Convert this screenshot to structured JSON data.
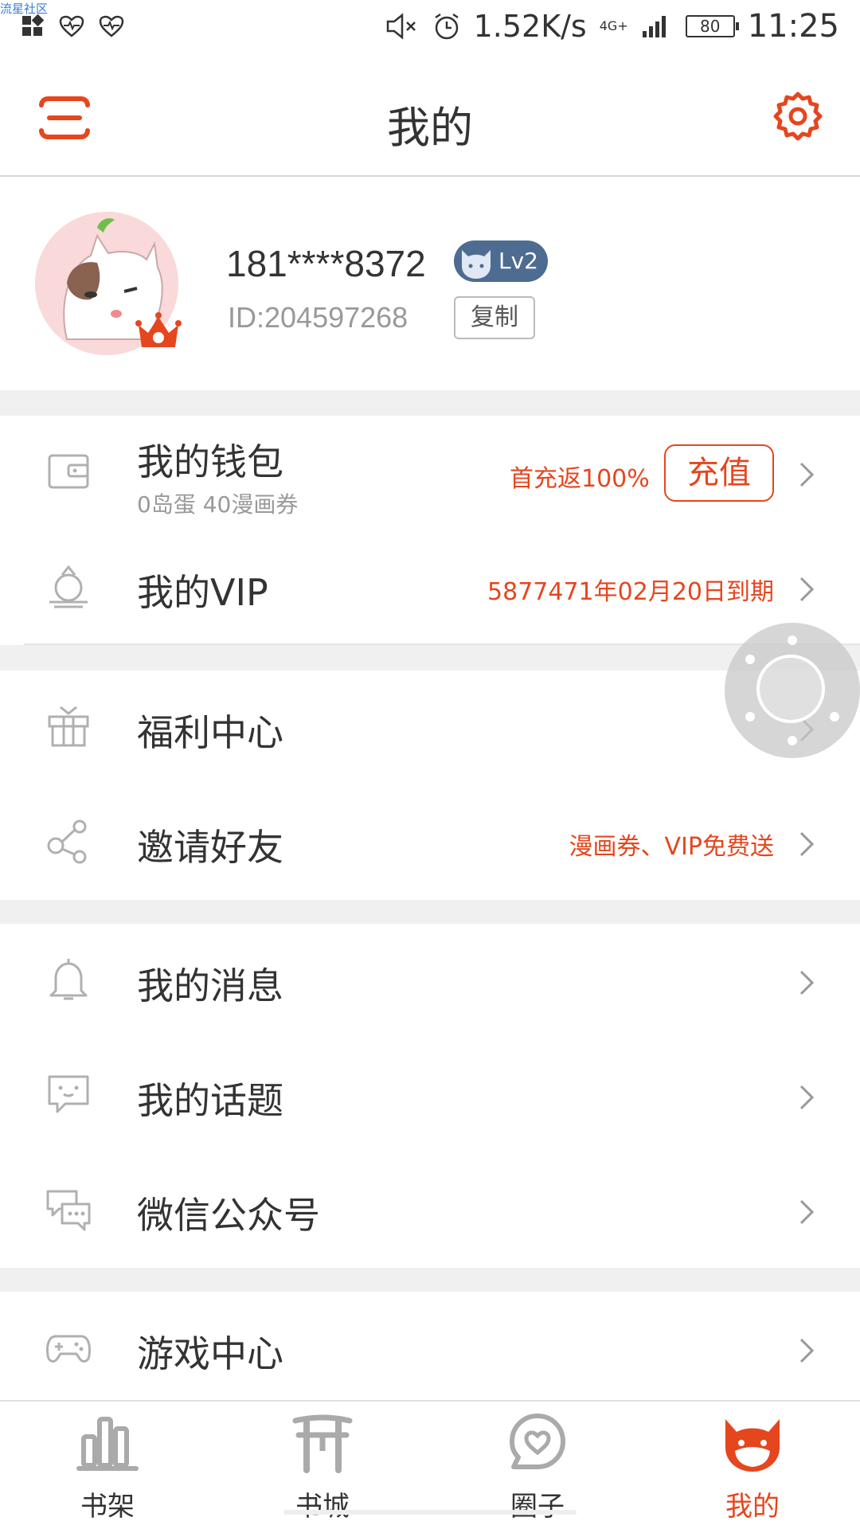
{
  "status_bar": {
    "corner_text": "流星社区",
    "network_speed": "1.52K/s",
    "network_type": "4G+",
    "battery": "80",
    "time": "11:25"
  },
  "header": {
    "title": "我的",
    "menu_icon": "menu-icon",
    "settings_icon": "gear-icon"
  },
  "profile": {
    "phone": "181****8372",
    "level": "Lv2",
    "user_id": "ID:204597268",
    "copy_label": "复制"
  },
  "wallet": {
    "title": "我的钱包",
    "balance": "0岛蛋 40漫画券",
    "promo": "首充返100%",
    "charge_label": "充值"
  },
  "vip": {
    "title": "我的VIP",
    "expiry": "5877471年02月20日到期"
  },
  "welfare": {
    "title": "福利中心"
  },
  "invite": {
    "title": "邀请好友",
    "note": "漫画券、VIP免费送"
  },
  "messages": {
    "title": "我的消息"
  },
  "topics": {
    "title": "我的话题"
  },
  "wechat": {
    "title": "微信公众号"
  },
  "games": {
    "title": "游戏中心"
  },
  "bottom_nav": {
    "items": [
      {
        "label": "书架",
        "icon": "bookshelf-icon"
      },
      {
        "label": "书城",
        "icon": "bookstore-icon"
      },
      {
        "label": "圈子",
        "icon": "community-icon"
      },
      {
        "label": "我的",
        "icon": "cat-face-icon",
        "active": true
      }
    ]
  },
  "colors": {
    "accent": "#e5461e",
    "text": "#333333",
    "muted": "#999999",
    "divider": "#f0f0f0",
    "level_badge": "#4e6c91"
  }
}
